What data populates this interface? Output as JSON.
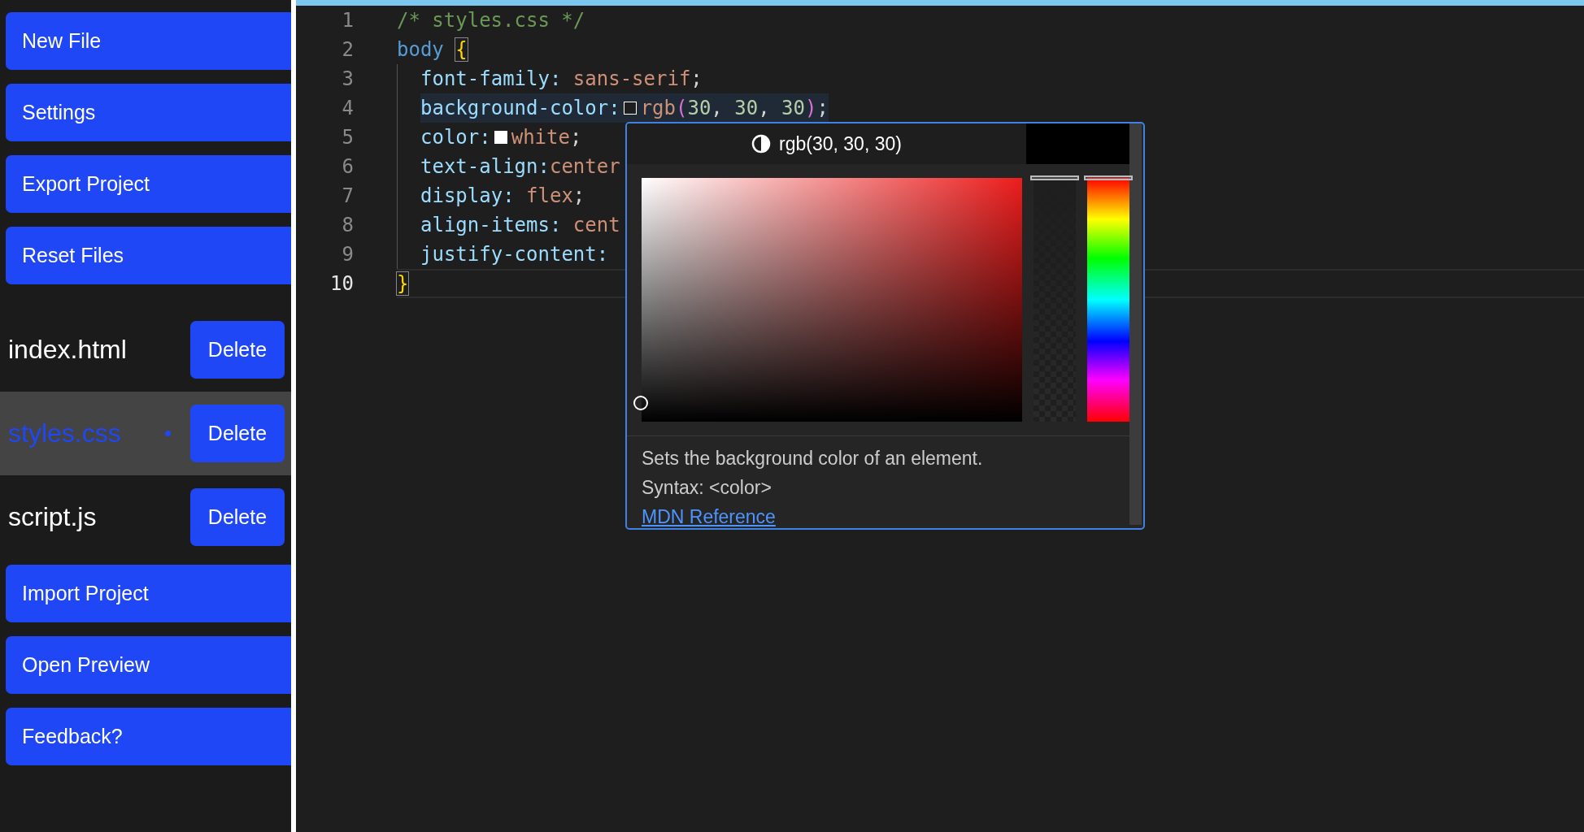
{
  "sidebar": {
    "top_actions": [
      "New File",
      "Settings",
      "Export Project",
      "Reset Files"
    ],
    "files": [
      {
        "name": "index.html",
        "selected": false,
        "modified": false,
        "action": "Delete"
      },
      {
        "name": "styles.css",
        "selected": true,
        "modified": true,
        "action": "Delete"
      },
      {
        "name": "script.js",
        "selected": false,
        "modified": false,
        "action": "Delete"
      }
    ],
    "bottom_actions": [
      "Import Project",
      "Open Preview",
      "Feedback?"
    ]
  },
  "editor": {
    "lines": [
      {
        "number": "1",
        "guide": false,
        "highlighted": false,
        "current": false,
        "tokens": [
          {
            "kind": "comment",
            "text": "/* styles.css */"
          }
        ]
      },
      {
        "number": "2",
        "guide": false,
        "highlighted": false,
        "current": false,
        "tokens": [
          {
            "kind": "selector",
            "text": "body "
          },
          {
            "kind": "brace",
            "text": "{",
            "matched": true
          }
        ]
      },
      {
        "number": "3",
        "guide": true,
        "highlighted": false,
        "current": false,
        "tokens": [
          {
            "kind": "property",
            "text": "font-family: "
          },
          {
            "kind": "value",
            "text": "sans-serif"
          },
          {
            "kind": "punct",
            "text": ";"
          }
        ]
      },
      {
        "number": "4",
        "guide": true,
        "highlighted": true,
        "current": false,
        "tokens": [
          {
            "kind": "property",
            "text": "background-color:"
          },
          {
            "kind": "swatch",
            "color": "#1e1e1e"
          },
          {
            "kind": "value",
            "text": "rgb"
          },
          {
            "kind": "paren",
            "text": "("
          },
          {
            "kind": "number",
            "text": "30"
          },
          {
            "kind": "punct",
            "text": ", "
          },
          {
            "kind": "number",
            "text": "30"
          },
          {
            "kind": "punct",
            "text": ", "
          },
          {
            "kind": "number",
            "text": "30"
          },
          {
            "kind": "paren",
            "text": ")"
          },
          {
            "kind": "punct",
            "text": ";"
          }
        ]
      },
      {
        "number": "5",
        "guide": true,
        "highlighted": false,
        "current": false,
        "tokens": [
          {
            "kind": "property",
            "text": "color:"
          },
          {
            "kind": "swatch",
            "color": "#ffffff"
          },
          {
            "kind": "value",
            "text": "white"
          },
          {
            "kind": "punct",
            "text": ";"
          }
        ]
      },
      {
        "number": "6",
        "guide": true,
        "highlighted": false,
        "current": false,
        "tokens": [
          {
            "kind": "property",
            "text": "text-align:"
          },
          {
            "kind": "value",
            "text": "center"
          }
        ]
      },
      {
        "number": "7",
        "guide": true,
        "highlighted": false,
        "current": false,
        "tokens": [
          {
            "kind": "property",
            "text": "display: "
          },
          {
            "kind": "value",
            "text": "flex"
          },
          {
            "kind": "punct",
            "text": ";"
          }
        ]
      },
      {
        "number": "8",
        "guide": true,
        "highlighted": false,
        "current": false,
        "tokens": [
          {
            "kind": "property",
            "text": "align-items: "
          },
          {
            "kind": "value",
            "text": "cent"
          }
        ]
      },
      {
        "number": "9",
        "guide": true,
        "highlighted": false,
        "current": false,
        "tokens": [
          {
            "kind": "property",
            "text": "justify-content:"
          }
        ]
      },
      {
        "number": "10",
        "guide": false,
        "highlighted": false,
        "current": true,
        "tokens": [
          {
            "kind": "brace",
            "text": "}",
            "matched": true
          }
        ]
      }
    ]
  },
  "hover": {
    "color_label": "rgb(30, 30, 30)",
    "opacity_slider": {
      "level": 1
    },
    "hue_slider": {
      "level": 0
    },
    "description": "Sets the background color of an element.",
    "syntax": "Syntax: <color>",
    "link": "MDN Reference"
  }
}
